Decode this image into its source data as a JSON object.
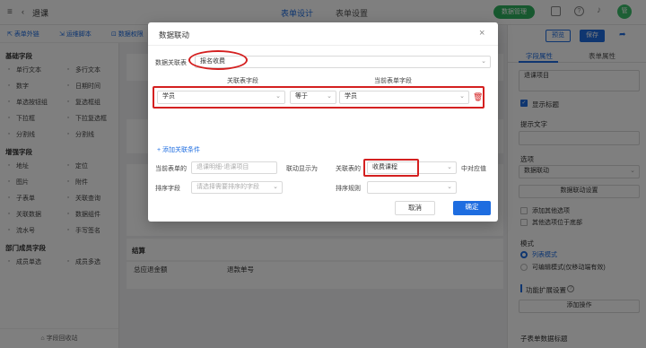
{
  "topbar": {
    "back_label": "退课",
    "tab_design": "表单设计",
    "tab_settings": "表单设置",
    "data_manage_label": "数据管理",
    "avatar_text": "管"
  },
  "toolbar": {
    "form_link": "表单外链",
    "push_script": "运维脚本",
    "data_permission": "数据权限"
  },
  "leftpanel": {
    "basic_title": "基础字段",
    "basic_fields": [
      "单行文本",
      "多行文本",
      "数字",
      "日期时间",
      "单选按钮组",
      "复选框组",
      "下拉框",
      "下拉复选框",
      "分割线",
      "分割线"
    ],
    "enhanced_title": "增强字段",
    "enhanced_fields": [
      "地址",
      "定位",
      "图片",
      "附件",
      "子表单",
      "关联查询",
      "关联数据",
      "数据组件",
      "流水号",
      "手写签名"
    ],
    "dept_title": "部门成员字段",
    "dept_fields": [
      "成员单选",
      "成员多选"
    ],
    "recycle_label": "字段回收站"
  },
  "canvas": {
    "settle_title": "结算",
    "refund_total_label": "总应退金额",
    "refund_no_label": "退款单号"
  },
  "rightpanel": {
    "preview_label": "预览",
    "save_label": "保存",
    "tab_field": "字段属性",
    "tab_form": "表单属性",
    "title_value": "退课项目",
    "show_title_label": "显示标题",
    "hint_label": "提示文字",
    "options_label": "选项",
    "options_value": "数据联动",
    "linkage_btn": "数据联动设置",
    "add_other_label": "添加其他选项",
    "other_below_label": "其他选项位于底部",
    "mode_label": "模式",
    "mode_list": "列表模式",
    "mode_edit": "可编辑模式(仅移动端有效)",
    "ext_label": "功能扩展设置",
    "add_op_label": "添加操作",
    "subform_label": "子表单数据标题"
  },
  "modal": {
    "title": "数据联动",
    "source_form_label": "数据关联表",
    "source_form_value": "报名收费",
    "col_related": "关联表字段",
    "col_current": "当前表单字段",
    "cond_left": "学员",
    "cond_op": "等于",
    "cond_right": "学员",
    "add_condition": "添加关联条件",
    "current_field_label": "当前表单的",
    "current_field_value": "退课明细-退课项目",
    "linkage_show": "联动显示为",
    "related_label": "关联表的",
    "related_value": "收费课程",
    "corresponding": "中对应值",
    "sort_field_label": "排序字段",
    "sort_field_ph": "请选择需要排序的字段",
    "sort_rule_label": "排序规则",
    "cancel": "取消",
    "confirm": "确定"
  },
  "colors": {
    "accent": "#1e6de0",
    "green": "#2fb15e",
    "red_mark": "#d42020"
  }
}
